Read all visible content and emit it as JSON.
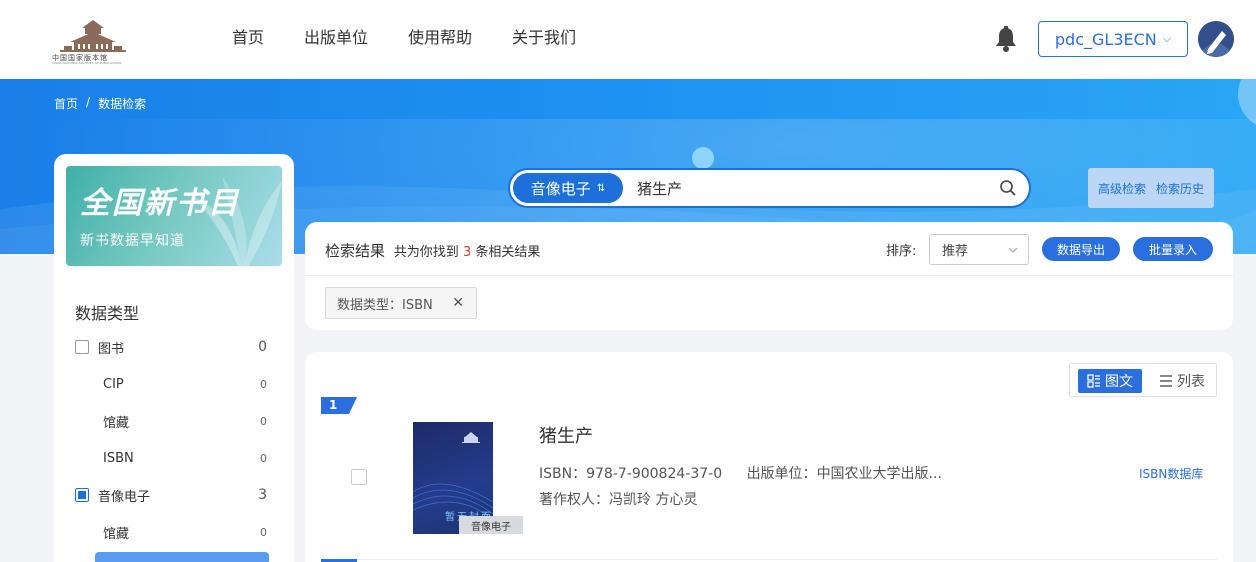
{
  "header": {
    "logo_text": "中国国家版本馆",
    "logo_subtext": "CHINA NATIONAL ARCHIVES OF PUBLICATIONS",
    "nav": [
      "首页",
      "出版单位",
      "使用帮助",
      "关于我们"
    ],
    "username": "pdc_GL3ECN",
    "user_chevron": "⌵",
    "bell_icon": "bell-icon",
    "avatar_icon": "user-avatar-icon"
  },
  "breadcrumb": {
    "home": "首页",
    "sep": "/",
    "current": "数据检索"
  },
  "search": {
    "type_label": "音像电子",
    "swap_glyph": "⇅",
    "query": "猪生产",
    "advanced": "高级检索",
    "history": "检索历史"
  },
  "promo": {
    "title": "全国新书目",
    "subtitle": "新书数据早知道"
  },
  "filters": {
    "title": "数据类型",
    "items": [
      {
        "label": "图书",
        "count": "0",
        "checked": false,
        "level": 0
      },
      {
        "label": "CIP",
        "count": "0",
        "level": 1
      },
      {
        "label": "馆藏",
        "count": "0",
        "level": 1
      },
      {
        "label": "ISBN",
        "count": "0",
        "level": 1
      },
      {
        "label": "音像电子",
        "count": "3",
        "checked": true,
        "level": 0
      },
      {
        "label": "馆藏",
        "count": "0",
        "level": 1
      }
    ]
  },
  "results": {
    "title": "检索结果",
    "summary_prefix": "共为你找到",
    "total": "3",
    "summary_suffix": "条相关结果",
    "sort_label": "排序:",
    "sort_value": "推荐",
    "export_btn": "数据导出",
    "batch_btn": "批量录入",
    "active_tag": "数据类型：ISBN",
    "tag_close": "✕"
  },
  "view": {
    "grid_label": "图文",
    "list_label": "列表",
    "active": "grid"
  },
  "items": [
    {
      "index": "1",
      "title": "猪生产",
      "isbn_label": "ISBN：",
      "isbn": "978-7-900824-37-0",
      "publisher_label": "出版单位：",
      "publisher": "中国农业大学出版...",
      "author_label": "著作权人：",
      "authors": "冯凯玲 方心灵",
      "cover_placeholder": "暂无封面",
      "media_tag": "音像电子",
      "db_link": "ISBN数据库"
    }
  ],
  "colors": {
    "primary": "#2b6fde",
    "banner": "#1c8ef0",
    "accent_red": "#e53935"
  }
}
